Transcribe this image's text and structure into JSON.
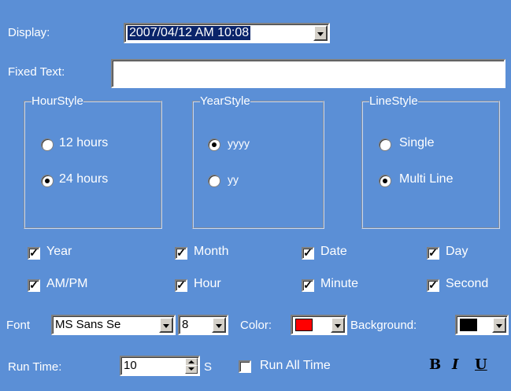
{
  "display": {
    "label": "Display:",
    "value": "2007/04/12 AM 10:08"
  },
  "fixed_text": {
    "label": "Fixed Text:",
    "value": ""
  },
  "hour_style": {
    "title": "HourStyle",
    "options": [
      "12 hours",
      "24 hours"
    ],
    "selected": "24 hours"
  },
  "year_style": {
    "title": "YearStyle",
    "options": [
      "yyyy",
      "yy"
    ],
    "selected": "yyyy"
  },
  "line_style": {
    "title": "LineStyle",
    "options": [
      "Single",
      "Multi Line"
    ],
    "selected": "Multi Line"
  },
  "checkboxes": {
    "year": "Year",
    "month": "Month",
    "date": "Date",
    "day": "Day",
    "ampm": "AM/PM",
    "hour": "Hour",
    "minute": "Minute",
    "second": "Second"
  },
  "font": {
    "label": "Font",
    "name": "MS Sans Se",
    "size": "8"
  },
  "color": {
    "label": "Color:",
    "value": "#ff0000"
  },
  "background": {
    "label": "Background:",
    "value": "#000000"
  },
  "run_time": {
    "label": "Run Time:",
    "value": "10",
    "unit": "S",
    "all_time_label": "Run All Time",
    "all_time_checked": false
  },
  "format_buttons": {
    "bold": "B",
    "italic": "I",
    "underline": "U"
  }
}
